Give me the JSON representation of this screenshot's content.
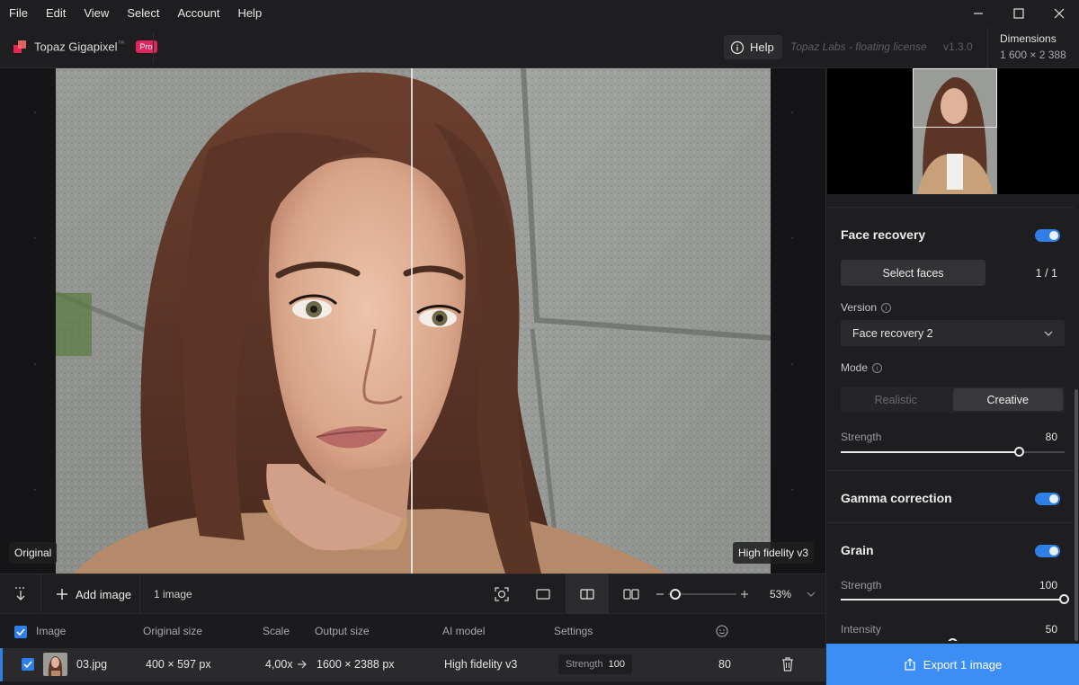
{
  "menu": [
    "File",
    "Edit",
    "View",
    "Select",
    "Account",
    "Help"
  ],
  "app": {
    "name": "Topaz Gigapixel",
    "tm": "™",
    "badge": "Pro",
    "help_label": "Help",
    "license": "Topaz Labs - floating license",
    "version": "v1.3.0",
    "dimensions_label": "Dimensions",
    "dimensions_value": "1 600 × 2 388"
  },
  "preview": {
    "left_tag": "Original",
    "right_tag": "High fidelity v3"
  },
  "toolbar": {
    "add_image": "Add image",
    "image_count": "1 image",
    "zoom": "53%",
    "zoom_level": 0.05
  },
  "table": {
    "headers": [
      "Image",
      "Original size",
      "Scale",
      "Output size",
      "AI model",
      "Settings"
    ],
    "row": {
      "name": "03.jpg",
      "original_size": "400 × 597 px",
      "scale": "4,00x",
      "output_size": "1600 × 2388 px",
      "model": "High fidelity v3",
      "settings_label": "Strength",
      "settings_value": "100",
      "face_value": "80"
    }
  },
  "panel": {
    "face_recovery": {
      "title": "Face recovery",
      "enabled": true,
      "select_faces": "Select faces",
      "face_count": "1 / 1",
      "version_label": "Version",
      "version_value": "Face recovery 2",
      "mode_label": "Mode",
      "mode_options": [
        "Realistic",
        "Creative"
      ],
      "mode_selected": "Creative",
      "strength_label": "Strength",
      "strength_value": "80",
      "strength_level": 0.8
    },
    "gamma": {
      "title": "Gamma correction",
      "enabled": true
    },
    "grain": {
      "title": "Grain",
      "enabled": true,
      "strength_label": "Strength",
      "strength_value": "100",
      "strength_level": 1.0,
      "intensity_label": "Intensity",
      "intensity_value": "50",
      "intensity_level": 0.5
    }
  },
  "export_label": "Export 1 image",
  "colors": {
    "accent": "#2f7fe6",
    "export": "#3c8ef5",
    "pro_badge": "#e0245e"
  }
}
